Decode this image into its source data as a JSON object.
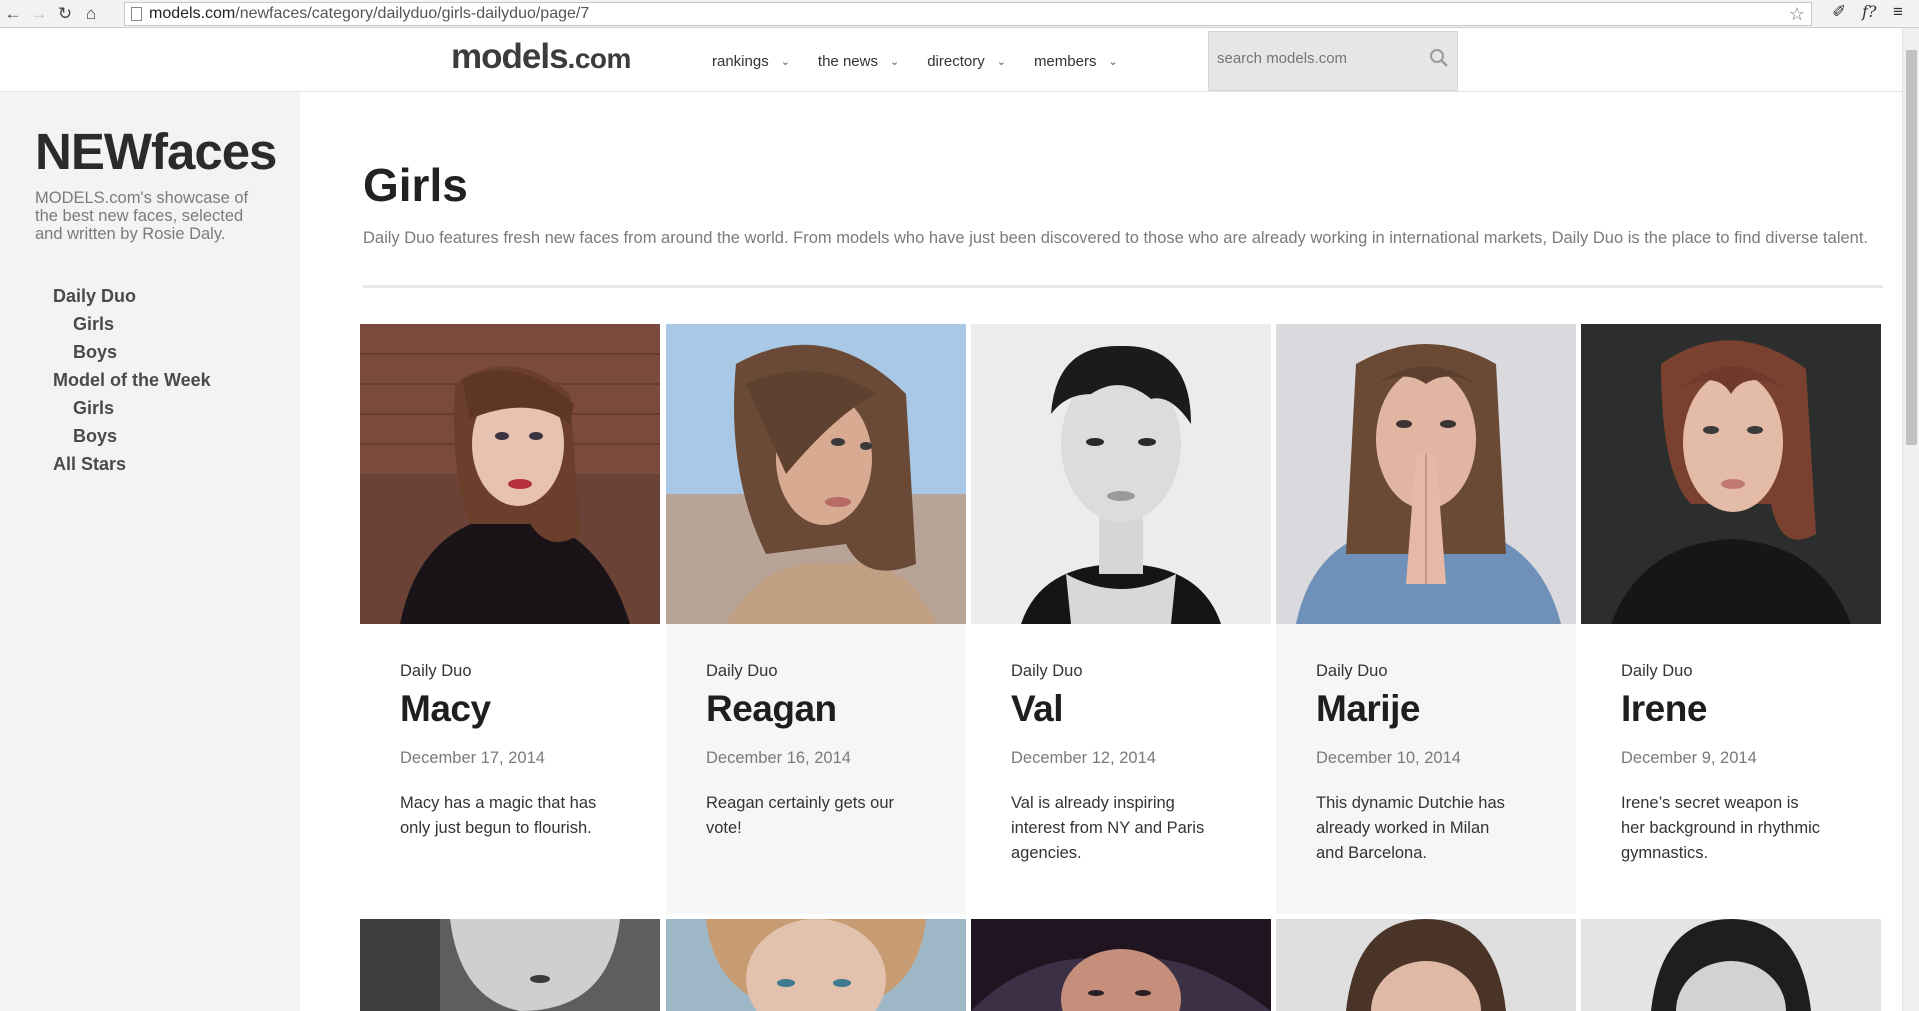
{
  "browser": {
    "back_icon": "arrow-left-icon",
    "forward_icon": "arrow-right-icon",
    "reload_icon": "reload-icon",
    "home_icon": "home-icon",
    "url_host": "models.com",
    "url_path": "/newfaces/category/dailyduo/girls-dailyduo/page/7",
    "bookmark_icon": "star-icon",
    "extensions": [
      "extension-icon",
      "f?",
      "menu-icon"
    ]
  },
  "header": {
    "logo_main": "models",
    "logo_suffix": ".com",
    "nav": [
      {
        "label": "rankings"
      },
      {
        "label": "the news"
      },
      {
        "label": "directory"
      },
      {
        "label": "members"
      }
    ],
    "search_placeholder": "search models.com"
  },
  "sidebar": {
    "brand": "NEWfaces",
    "tagline": "MODELS.com's showcase of the best new faces, selected and written by Rosie Daly.",
    "nav": [
      {
        "label": "Daily Duo",
        "level": 1
      },
      {
        "label": "Girls",
        "level": 2
      },
      {
        "label": "Boys",
        "level": 2
      },
      {
        "label": "Model of the Week",
        "level": 1
      },
      {
        "label": "Girls",
        "level": 2
      },
      {
        "label": "Boys",
        "level": 2
      },
      {
        "label": "All Stars",
        "level": 1
      }
    ]
  },
  "main": {
    "title": "Girls",
    "intro": "Daily Duo features fresh new faces from around the world. From models who have just been discovered to those who are already working in international markets, Daily Duo is the place to find diverse talent.",
    "cards": [
      {
        "category": "Daily Duo",
        "name": "Macy",
        "date": "December 17, 2014",
        "blurb": "Macy has a magic that has only just begun to flourish."
      },
      {
        "category": "Daily Duo",
        "name": "Reagan",
        "date": "December 16, 2014",
        "blurb": "Reagan certainly gets our vote!"
      },
      {
        "category": "Daily Duo",
        "name": "Val",
        "date": "December 12, 2014",
        "blurb": "Val is already inspiring interest from NY and Paris agencies."
      },
      {
        "category": "Daily Duo",
        "name": "Marije",
        "date": "December 10, 2014",
        "blurb": "This dynamic Dutchie has already worked in Milan and Barcelona."
      },
      {
        "category": "Daily Duo",
        "name": "Irene",
        "date": "December 9, 2014",
        "blurb": "Irene’s secret weapon is her background in rhythmic gymnastics."
      }
    ]
  }
}
